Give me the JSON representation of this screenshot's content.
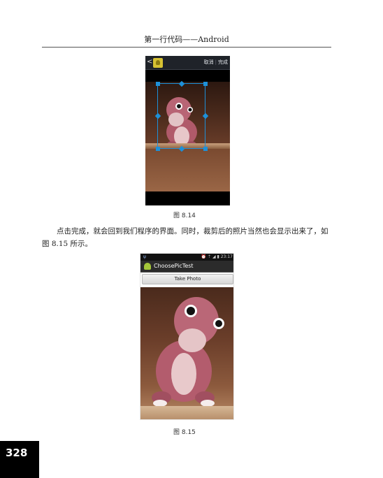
{
  "header": {
    "title": "第一行代码——Android"
  },
  "figure1": {
    "back_glyph": "<",
    "cancel_label": "取消",
    "done_label": "完成",
    "caption": "图   8.14"
  },
  "paragraph": "点击完成，就会回到我们程序的界面。同时，裁剪后的照片当然也会显示出来了，如图 8.15 所示。",
  "figure2": {
    "status_time": "23:17",
    "status_icons": "⏰ ⇡ ◢ ▮",
    "app_title": "ChoosePicTest",
    "button_label": "Take Photo",
    "caption": "图   8.15"
  },
  "page_number": "328",
  "colors": {
    "crop_frame": "#1e90d8",
    "page_box": "#000000",
    "android": "#a4c639"
  }
}
